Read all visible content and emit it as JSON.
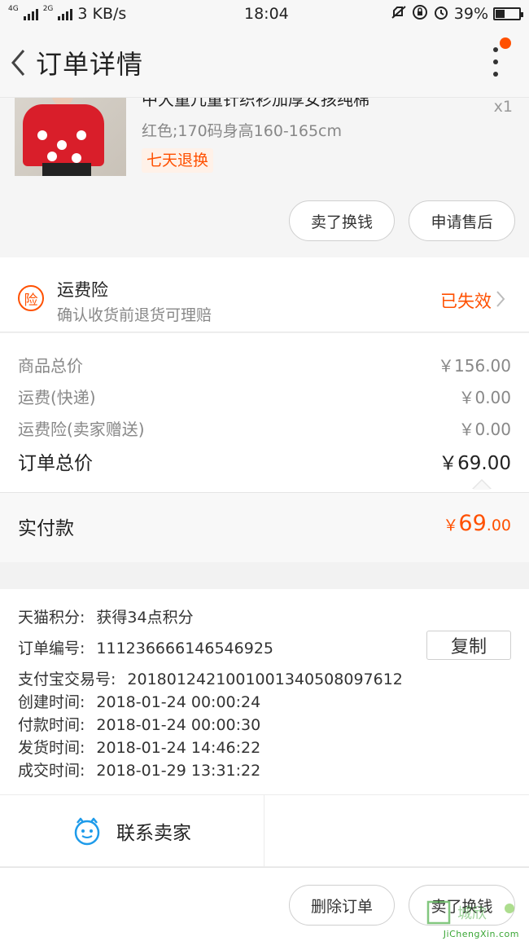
{
  "status_bar": {
    "network_small_1": "4G",
    "network_small_2": "2G",
    "speed": "3 KB/s",
    "time": "18:04",
    "battery_percent": "39%",
    "battery_level": 0.39
  },
  "nav": {
    "title": "订单详情"
  },
  "product": {
    "name": "中大童儿童针织衫加厚女孩纯棉",
    "sku": "红色;170码身高160-165cm",
    "quantity": "x1",
    "tag": "七天退换",
    "buttons": [
      "卖了换钱",
      "申请售后"
    ]
  },
  "insurance": {
    "icon_text": "险",
    "title": "运费险",
    "subtitle": "确认收货前退货可理赔",
    "status": "已失效"
  },
  "price": {
    "rows": [
      {
        "label": "商品总价",
        "value": "￥156.00"
      },
      {
        "label": "运费(快递)",
        "value": "￥0.00"
      },
      {
        "label": "运费险(卖家赠送)",
        "value": "￥0.00"
      }
    ],
    "total_label": "订单总价",
    "total_value": "￥69.00",
    "paid_label": "实付款",
    "paid_currency": "￥",
    "paid_integer": "69",
    "paid_decimal": ".00"
  },
  "order_info": {
    "points_label": "天猫积分:",
    "points_value": "获得34点积分",
    "order_no_label": "订单编号:",
    "order_no_value": "111236666146546925",
    "copy_button": "复制",
    "alipay_label": "支付宝交易号:",
    "alipay_value": "2018012421001001340508097612",
    "created_label": "创建时间:",
    "created_value": "2018-01-24 00:00:24",
    "paid_time_label": "付款时间:",
    "paid_time_value": "2018-01-24 00:00:30",
    "shipped_label": "发货时间:",
    "shipped_value": "2018-01-24 14:46:22",
    "completed_label": "成交时间:",
    "completed_value": "2018-01-29 13:31:22"
  },
  "contact": {
    "label": "联系卖家"
  },
  "bottom": {
    "delete_button": "删除订单",
    "sell_button": "卖了换钱"
  },
  "watermark": {
    "text": "JiChengXin.com"
  },
  "colors": {
    "accent": "#ff5000",
    "contact_blue": "#1e9bea"
  }
}
